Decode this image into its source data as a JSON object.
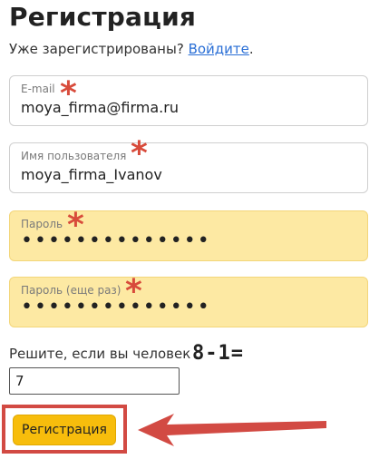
{
  "title": "Регистрация",
  "login_prompt": {
    "text": "Уже зарегистрированы? ",
    "link": "Войдите",
    "tail": "."
  },
  "fields": {
    "email": {
      "label": "E-mail",
      "value": "moya_firma@firma.ru",
      "required_mark": "*"
    },
    "username": {
      "label": "Имя пользователя",
      "value": "moya_firma_Ivanov",
      "required_mark": "*"
    },
    "password": {
      "label": "Пароль",
      "value": "••••••••••••••",
      "required_mark": "*"
    },
    "password_repeat": {
      "label": "Пароль (еще раз)",
      "value": "••••••••••••••",
      "required_mark": "*"
    }
  },
  "captcha": {
    "prompt": "Решите, если вы человек :",
    "expression": "8-1=",
    "answer": "7"
  },
  "submit_label": "Регистрация",
  "colors": {
    "accent_yellow": "#f7bd0c",
    "password_bg": "#fde9a3",
    "highlight_red": "#d24a43",
    "link_blue": "#2a6fd6"
  }
}
